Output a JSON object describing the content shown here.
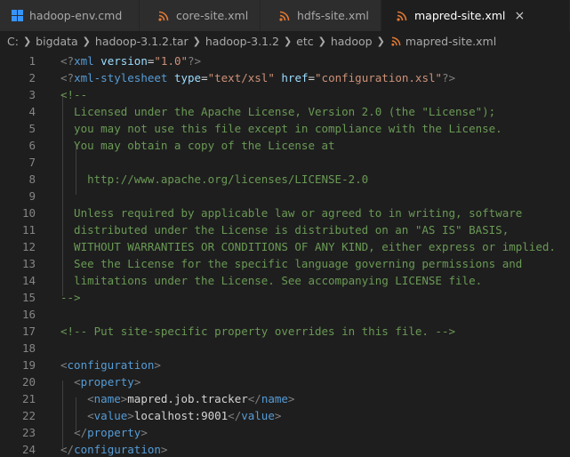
{
  "tabs": [
    {
      "label": "hadoop-env.cmd",
      "icon": "windows-icon",
      "active": false
    },
    {
      "label": "core-site.xml",
      "icon": "rss-icon",
      "active": false
    },
    {
      "label": "hdfs-site.xml",
      "icon": "rss-icon",
      "active": false
    },
    {
      "label": "mapred-site.xml",
      "icon": "rss-icon",
      "active": true,
      "close": "×"
    }
  ],
  "breadcrumb": [
    "C:",
    "bigdata",
    "hadoop-3.1.2.tar",
    "hadoop-3.1.2",
    "etc",
    "hadoop",
    "mapred-site.xml"
  ],
  "colors": {
    "tag": "#569cd6",
    "attr": "#9cdcfe",
    "string": "#ce9178",
    "comment": "#6a9955",
    "rss": "#e37933",
    "windows": "#3794ff"
  },
  "lines": [
    {
      "n": "1",
      "tokens": [
        [
          "punc",
          "<?"
        ],
        [
          "tag",
          "xml"
        ],
        [
          "txt",
          " "
        ],
        [
          "attr",
          "version"
        ],
        [
          "txt",
          "="
        ],
        [
          "str",
          "\"1.0\""
        ],
        [
          "punc",
          "?>"
        ]
      ]
    },
    {
      "n": "2",
      "tokens": [
        [
          "punc",
          "<?"
        ],
        [
          "tag",
          "xml-stylesheet"
        ],
        [
          "txt",
          " "
        ],
        [
          "attr",
          "type"
        ],
        [
          "txt",
          "="
        ],
        [
          "str",
          "\"text/xsl\""
        ],
        [
          "txt",
          " "
        ],
        [
          "attr",
          "href"
        ],
        [
          "txt",
          "="
        ],
        [
          "str",
          "\"configuration.xsl\""
        ],
        [
          "punc",
          "?>"
        ]
      ]
    },
    {
      "n": "3",
      "tokens": [
        [
          "com",
          "<!--"
        ]
      ]
    },
    {
      "n": "4",
      "tokens": [
        [
          "com",
          "  Licensed under the Apache License, Version 2.0 (the \"License\");"
        ]
      ]
    },
    {
      "n": "5",
      "tokens": [
        [
          "com",
          "  you may not use this file except in compliance with the License."
        ]
      ]
    },
    {
      "n": "6",
      "tokens": [
        [
          "com",
          "  You may obtain a copy of the License at"
        ]
      ]
    },
    {
      "n": "7",
      "tokens": []
    },
    {
      "n": "8",
      "tokens": [
        [
          "com",
          "    http://www.apache.org/licenses/LICENSE-2.0"
        ]
      ]
    },
    {
      "n": "9",
      "tokens": []
    },
    {
      "n": "10",
      "tokens": [
        [
          "com",
          "  Unless required by applicable law or agreed to in writing, software"
        ]
      ]
    },
    {
      "n": "11",
      "tokens": [
        [
          "com",
          "  distributed under the License is distributed on an \"AS IS\" BASIS,"
        ]
      ]
    },
    {
      "n": "12",
      "tokens": [
        [
          "com",
          "  WITHOUT WARRANTIES OR CONDITIONS OF ANY KIND, either express or implied."
        ]
      ]
    },
    {
      "n": "13",
      "tokens": [
        [
          "com",
          "  See the License for the specific language governing permissions and"
        ]
      ]
    },
    {
      "n": "14",
      "tokens": [
        [
          "com",
          "  limitations under the License. See accompanying LICENSE file."
        ]
      ]
    },
    {
      "n": "15",
      "tokens": [
        [
          "com",
          "-->"
        ]
      ]
    },
    {
      "n": "16",
      "tokens": []
    },
    {
      "n": "17",
      "tokens": [
        [
          "com",
          "<!-- Put site-specific property overrides in this file. -->"
        ]
      ]
    },
    {
      "n": "18",
      "tokens": []
    },
    {
      "n": "19",
      "tokens": [
        [
          "punc",
          "<"
        ],
        [
          "tag",
          "configuration"
        ],
        [
          "punc",
          ">"
        ]
      ]
    },
    {
      "n": "20",
      "tokens": [
        [
          "txt",
          "  "
        ],
        [
          "punc",
          "<"
        ],
        [
          "tag",
          "property"
        ],
        [
          "punc",
          ">"
        ]
      ]
    },
    {
      "n": "21",
      "tokens": [
        [
          "txt",
          "    "
        ],
        [
          "punc",
          "<"
        ],
        [
          "tag",
          "name"
        ],
        [
          "punc",
          ">"
        ],
        [
          "txt",
          "mapred.job.tracker"
        ],
        [
          "punc",
          "</"
        ],
        [
          "tag",
          "name"
        ],
        [
          "punc",
          ">"
        ]
      ]
    },
    {
      "n": "22",
      "tokens": [
        [
          "txt",
          "    "
        ],
        [
          "punc",
          "<"
        ],
        [
          "tag",
          "value"
        ],
        [
          "punc",
          ">"
        ],
        [
          "txt",
          "localhost:9001"
        ],
        [
          "punc",
          "</"
        ],
        [
          "tag",
          "value"
        ],
        [
          "punc",
          ">"
        ]
      ]
    },
    {
      "n": "23",
      "tokens": [
        [
          "txt",
          "  "
        ],
        [
          "punc",
          "</"
        ],
        [
          "tag",
          "property"
        ],
        [
          "punc",
          ">"
        ]
      ]
    },
    {
      "n": "24",
      "tokens": [
        [
          "punc",
          "</"
        ],
        [
          "tag",
          "configuration"
        ],
        [
          "punc",
          ">"
        ]
      ]
    }
  ]
}
